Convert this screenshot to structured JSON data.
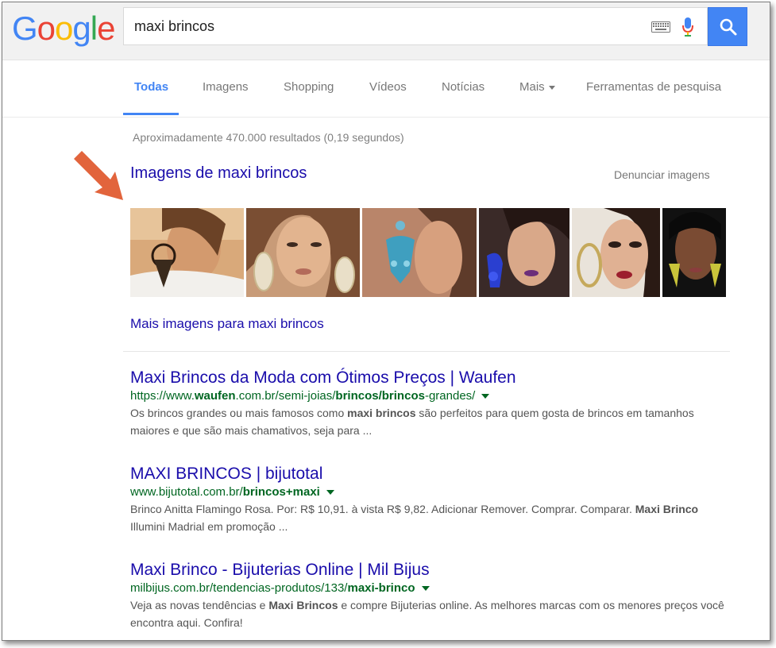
{
  "logo": {
    "letters": [
      "G",
      "o",
      "o",
      "g",
      "l",
      "e"
    ]
  },
  "colors": {
    "logo": [
      "#4285f4",
      "#ea4335",
      "#fbbc05",
      "#4285f4",
      "#34a853",
      "#ea4335"
    ],
    "link": "#1a0dab",
    "url": "#006621",
    "accent": "#4285f4"
  },
  "search": {
    "query": "maxi brincos"
  },
  "tabs": [
    {
      "label": "Todas"
    },
    {
      "label": "Imagens"
    },
    {
      "label": "Shopping"
    },
    {
      "label": "Vídeos"
    },
    {
      "label": "Notícias"
    },
    {
      "label": "Mais"
    },
    {
      "label": "Ferramentas de pesquisa"
    }
  ],
  "stats": "Aproximadamente 470.000 resultados (0,19 segundos)",
  "images": {
    "heading": "Imagens de maxi brincos",
    "report": "Denunciar imagens",
    "more": "Mais imagens para maxi brincos"
  },
  "results": [
    {
      "title": "Maxi Brincos da Moda com Ótimos Preços | Waufen",
      "url_parts": [
        "https://www.",
        "waufen",
        ".com.br/semi-joias/",
        "brincos",
        "/",
        "brincos",
        "-grandes/"
      ],
      "snippet_parts": [
        "Os brincos grandes ou mais famosos como ",
        "maxi brincos",
        " são perfeitos para quem gosta de brincos em tamanhos maiores e que são mais chamativos, seja para ..."
      ]
    },
    {
      "title": "MAXI BRINCOS | bijutotal",
      "url_parts": [
        "www.bijutotal.com.br/",
        "brincos+maxi"
      ],
      "snippet_parts": [
        "Brinco Anitta Flamingo Rosa. Por: R$ 10,91. à vista R$ 9,82. Adicionar Remover. Comprar. Comparar. ",
        "Maxi Brinco",
        " Illumini Madrial em promoção ..."
      ]
    },
    {
      "title": "Maxi Brinco - Bijuterias Online | Mil Bijus",
      "url_parts": [
        "milbijus.com.br/tendencias-produtos/133/",
        "maxi-brinco"
      ],
      "snippet_parts": [
        "Veja as novas tendências e ",
        "Maxi Brincos",
        " e compre Bijuterias online. As melhores marcas com os menores preços você encontra aqui. Confira!"
      ]
    }
  ]
}
